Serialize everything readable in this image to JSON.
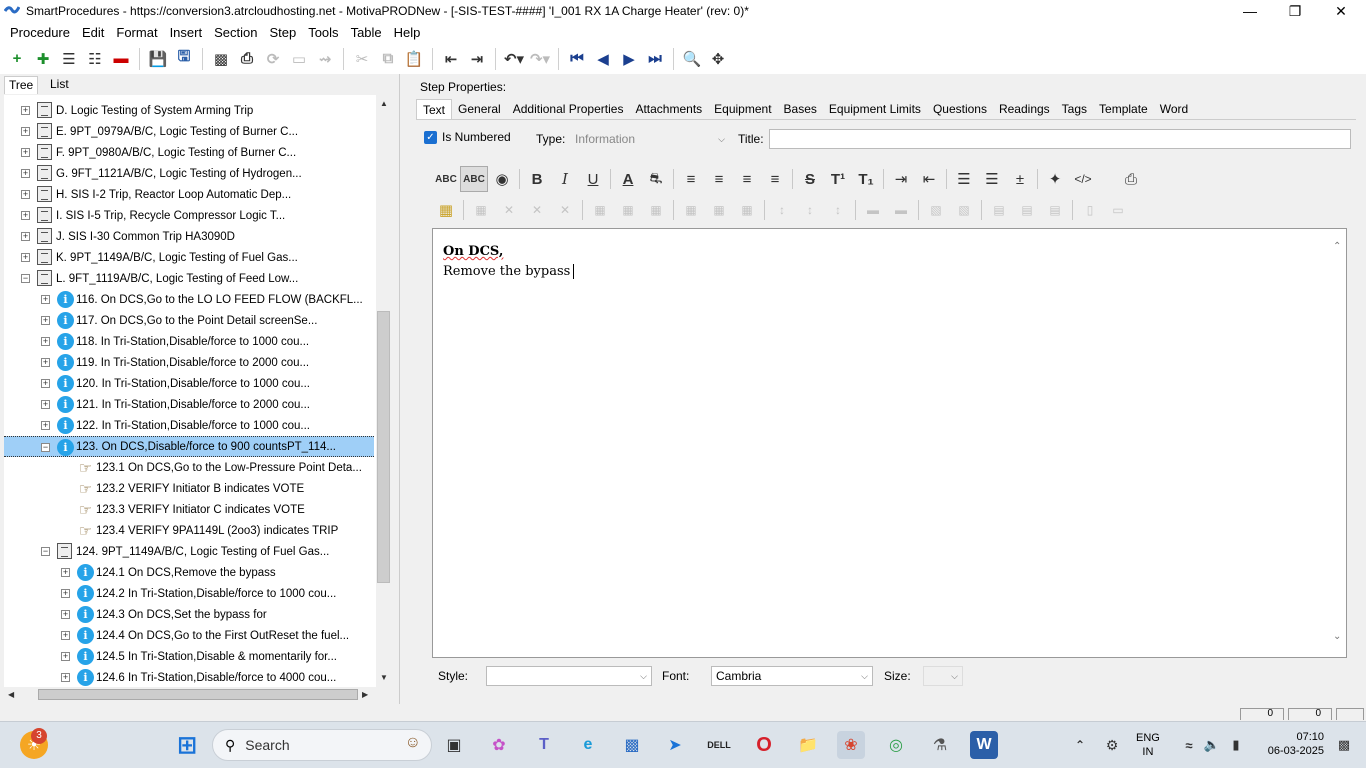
{
  "window": {
    "title": "SmartProcedures - https://conversion3.atrcloudhosting.net - MotivaPRODNew - [-SIS-TEST-####] 'I_001 RX 1A Charge Heater' (rev: 0)*"
  },
  "menu": [
    "Procedure",
    "Edit",
    "Format",
    "Insert",
    "Section",
    "Step",
    "Tools",
    "Table",
    "Help"
  ],
  "left_tabs": {
    "tree": "Tree",
    "list": "List"
  },
  "tree": [
    {
      "indent": 0,
      "icon": "doc",
      "label": "D. Logic Testing of System Arming Trip"
    },
    {
      "indent": 0,
      "icon": "doc",
      "label": "E. 9PT_0979A/B/C, Logic Testing of Burner C..."
    },
    {
      "indent": 0,
      "icon": "doc",
      "label": "F. 9PT_0980A/B/C, Logic Testing of Burner C..."
    },
    {
      "indent": 0,
      "icon": "doc",
      "label": "G. 9FT_1121A/B/C, Logic Testing of Hydrogen..."
    },
    {
      "indent": 0,
      "icon": "doc",
      "label": "H. SIS I-2 Trip, Reactor Loop Automatic Dep..."
    },
    {
      "indent": 0,
      "icon": "doc",
      "label": "I. SIS I-5 Trip, Recycle Compressor Logic T..."
    },
    {
      "indent": 0,
      "icon": "doc",
      "label": "J. SIS I-30 Common Trip HA3090D"
    },
    {
      "indent": 0,
      "icon": "doc",
      "label": "K. 9PT_1149A/B/C, Logic Testing of Fuel Gas..."
    },
    {
      "indent": 0,
      "icon": "doc",
      "label": "L. 9FT_1119A/B/C, Logic Testing of Feed Low...",
      "expanded": true
    },
    {
      "indent": 1,
      "icon": "info",
      "label": "116. On DCS,Go to the LO LO FEED FLOW (BACKFL..."
    },
    {
      "indent": 1,
      "icon": "info",
      "label": "117. On DCS,Go to the Point Detail screenSe..."
    },
    {
      "indent": 1,
      "icon": "info",
      "label": "118. In Tri-Station,Disable/force to 1000 cou..."
    },
    {
      "indent": 1,
      "icon": "info",
      "label": "119. In Tri-Station,Disable/force to 2000 cou..."
    },
    {
      "indent": 1,
      "icon": "info",
      "label": "120. In Tri-Station,Disable/force to 1000 cou..."
    },
    {
      "indent": 1,
      "icon": "info",
      "label": "121. In Tri-Station,Disable/force to 2000 cou..."
    },
    {
      "indent": 1,
      "icon": "info",
      "label": "122. In Tri-Station,Disable/force to 1000 cou..."
    },
    {
      "indent": 1,
      "icon": "info",
      "label": "123. On DCS,Disable/force to 900 countsPT_114...",
      "expanded": true,
      "selected": true
    },
    {
      "indent": 2,
      "icon": "hand",
      "label": "123.1 On DCS,Go to the Low-Pressure Point Deta..."
    },
    {
      "indent": 2,
      "icon": "hand",
      "label": "123.2 VERIFY Initiator B indicates VOTE"
    },
    {
      "indent": 2,
      "icon": "hand",
      "label": "123.3 VERIFY Initiator C indicates VOTE"
    },
    {
      "indent": 2,
      "icon": "hand",
      "label": "123.4 VERIFY 9PA1149L (2oo3) indicates TRIP"
    },
    {
      "indent": 1,
      "icon": "doc",
      "label": "124. 9PT_1149A/B/C, Logic Testing of Fuel Gas...",
      "expanded": true
    },
    {
      "indent": 2,
      "icon": "info",
      "label": "124.1 On DCS,Remove the bypass"
    },
    {
      "indent": 2,
      "icon": "info",
      "label": "124.2 In Tri-Station,Disable/force to 1000 cou..."
    },
    {
      "indent": 2,
      "icon": "info",
      "label": "124.3 On DCS,Set the bypass for"
    },
    {
      "indent": 2,
      "icon": "info",
      "label": "124.4 On DCS,Go to the First OutReset the fuel..."
    },
    {
      "indent": 2,
      "icon": "info",
      "label": "124.5 In Tri-Station,Disable & momentarily for..."
    },
    {
      "indent": 2,
      "icon": "info",
      "label": "124.6 In Tri-Station,Disable/force to 4000 cou..."
    }
  ],
  "step_properties": {
    "heading": "Step Properties:",
    "tabs": [
      "Text",
      "General",
      "Additional Properties",
      "Attachments",
      "Equipment",
      "Bases",
      "Equipment Limits",
      "Questions",
      "Readings",
      "Tags",
      "Template",
      "Word"
    ],
    "is_numbered_label": "Is Numbered",
    "type_label": "Type:",
    "type_value": "Information",
    "title_label": "Title:",
    "title_value": "",
    "editor_line1": "On DCS,",
    "editor_line2": "Remove the bypass",
    "style_label": "Style:",
    "style_value": "",
    "font_label": "Font:",
    "font_value": "Cambria",
    "size_label": "Size:",
    "size_value": ""
  },
  "status": {
    "box1": "0",
    "box2": "0"
  },
  "taskbar": {
    "search_placeholder": "Search",
    "notification_count": "3",
    "language": "ENG",
    "region": "IN",
    "time": "07:10",
    "date": "06-03-2025"
  }
}
